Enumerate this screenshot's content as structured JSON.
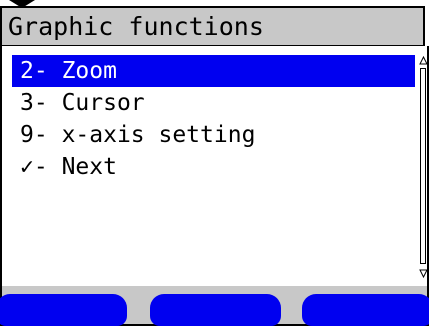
{
  "header": {
    "title": "Graphic functions"
  },
  "menu": {
    "items": [
      {
        "key": "2-",
        "label": "Zoom",
        "selected": true
      },
      {
        "key": "3-",
        "label": "Cursor",
        "selected": false
      },
      {
        "key": "9-",
        "label": "x-axis setting",
        "selected": false
      },
      {
        "key": "✓-",
        "label": "Next",
        "selected": false
      }
    ]
  },
  "softkeys": [
    {
      "label": ""
    },
    {
      "label": ""
    },
    {
      "label": ""
    }
  ],
  "colors": {
    "selection": "#0000f0",
    "titlebar": "#c8c8c8",
    "softkey": "#0000f0",
    "text": "#000000"
  }
}
